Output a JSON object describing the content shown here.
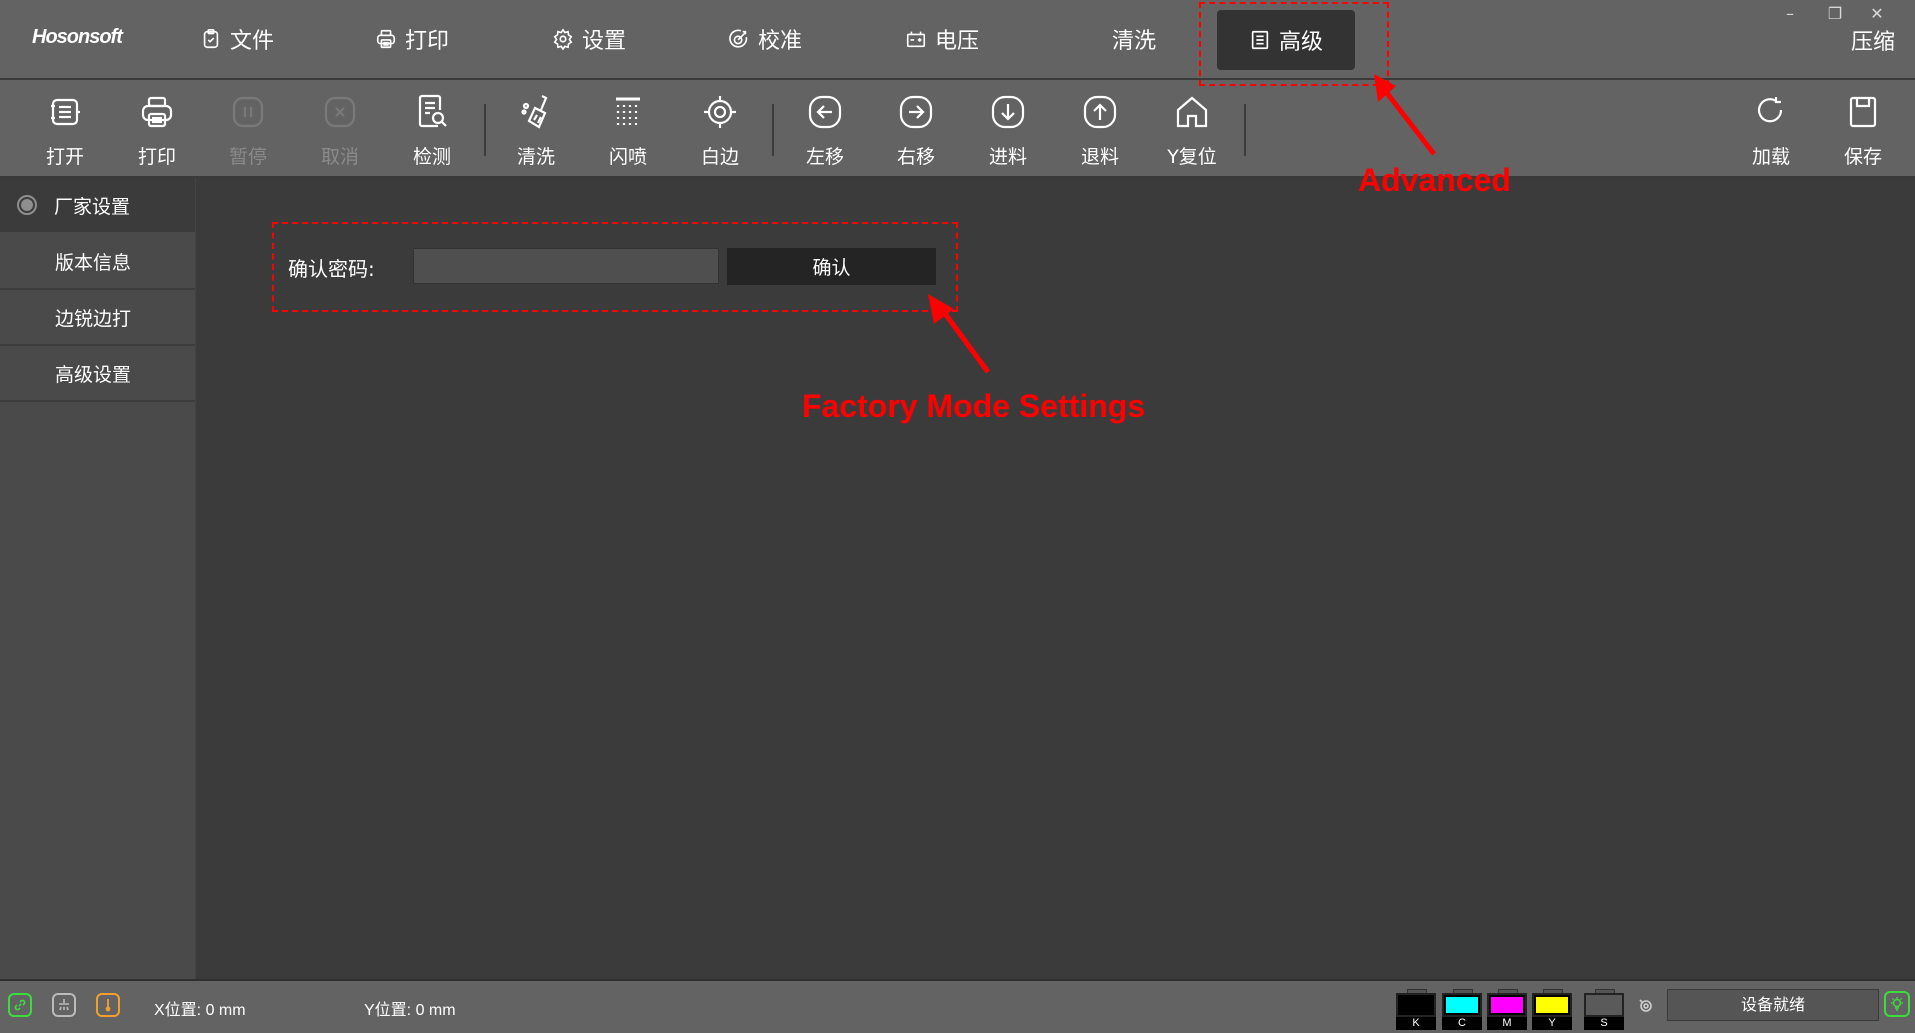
{
  "app": {
    "logo": "Hosonsoft"
  },
  "tabs": [
    {
      "label": "文件",
      "icon": "clipboard-check-icon"
    },
    {
      "label": "打印",
      "icon": "printer-icon"
    },
    {
      "label": "设置",
      "icon": "gear-icon"
    },
    {
      "label": "校准",
      "icon": "target-icon"
    },
    {
      "label": "电压",
      "icon": "battery-icon"
    },
    {
      "label": "清洗",
      "icon": ""
    },
    {
      "label": "高级",
      "icon": "document-list-icon",
      "active": true
    }
  ],
  "window": {
    "minimize": "–",
    "restore": "❐",
    "close": "✕",
    "compress_label": "压缩"
  },
  "toolbar": {
    "items": [
      {
        "label": "打开",
        "icon": "open-icon",
        "enabled": true
      },
      {
        "label": "打印",
        "icon": "printer-icon",
        "enabled": true
      },
      {
        "label": "暂停",
        "icon": "pause-icon",
        "enabled": false
      },
      {
        "label": "取消",
        "icon": "cancel-icon",
        "enabled": false
      },
      {
        "label": "检测",
        "icon": "inspect-icon",
        "enabled": true
      },
      {
        "label": "清洗",
        "icon": "brush-icon",
        "enabled": true
      },
      {
        "label": "闪喷",
        "icon": "spray-icon",
        "enabled": true
      },
      {
        "label": "白边",
        "icon": "crosshair-icon",
        "enabled": true
      },
      {
        "label": "左移",
        "icon": "arrow-left-icon",
        "enabled": true
      },
      {
        "label": "右移",
        "icon": "arrow-right-icon",
        "enabled": true
      },
      {
        "label": "进料",
        "icon": "arrow-down-icon",
        "enabled": true
      },
      {
        "label": "退料",
        "icon": "arrow-up-icon",
        "enabled": true
      },
      {
        "label": "Y复位",
        "icon": "home-icon",
        "enabled": true
      },
      {
        "label": "加载",
        "icon": "reload-icon",
        "enabled": true
      },
      {
        "label": "保存",
        "icon": "save-icon",
        "enabled": true
      }
    ]
  },
  "sidebar": {
    "header": "厂家设置",
    "items": [
      {
        "label": "版本信息"
      },
      {
        "label": "边锐边打"
      },
      {
        "label": "高级设置"
      }
    ]
  },
  "content": {
    "password_label": "确认密码:",
    "password_value": "",
    "password_placeholder": "",
    "confirm_button": "确认"
  },
  "annotations": {
    "advanced": "Advanced",
    "factory_mode": "Factory Mode Settings",
    "color": "#ff0000"
  },
  "status": {
    "x_position": "X位置: 0 mm",
    "y_position": "Y位置: 0 mm",
    "device_status": "设备就绪",
    "inks": [
      {
        "label": "K",
        "color": "#000000"
      },
      {
        "label": "C",
        "color": "#00ffff"
      },
      {
        "label": "M",
        "color": "#ff00ff"
      },
      {
        "label": "Y",
        "color": "#ffff00"
      },
      {
        "label": "S",
        "color": ""
      }
    ],
    "icon_colors": {
      "link": "#3ddc3d",
      "nozzle": "#bbbbbb",
      "temperature": "#f0a030",
      "light": "#3ddc3d"
    }
  }
}
